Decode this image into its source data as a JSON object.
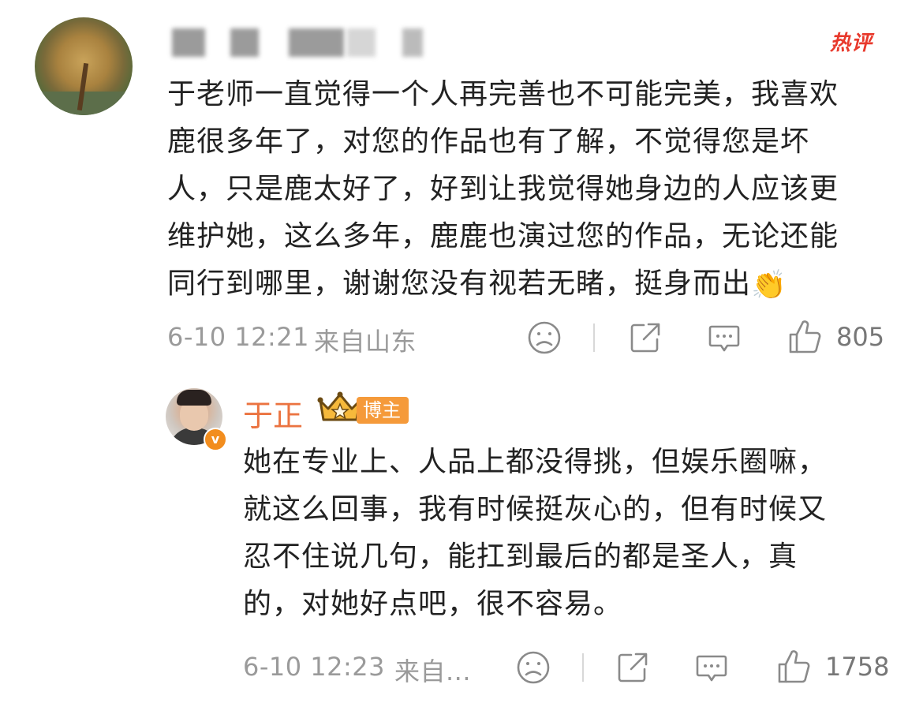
{
  "comment": {
    "hot_tag": "热评",
    "text_lines": [
      "于老师一直觉得一个人再完善也不可能完美，我喜欢",
      "鹿很多年了，对您的作品也有了解，不觉得您是坏",
      "人，只是鹿太好了，好到让我觉得她身边的人应该更",
      "维护她，这么多年，鹿鹿也演过您的作品，无论还能",
      "同行到哪里，谢谢您没有视若无睹，挺身而出"
    ],
    "emoji": "👏",
    "timestamp": "6-10 12:21",
    "location": "来自山东",
    "like_count": "805"
  },
  "reply": {
    "author": "于正",
    "badge_label": "博主",
    "verified_mark": "v",
    "text_lines": [
      "她在专业上、人品上都没得挑，但娱乐圈嘛，",
      "就这么回事，我有时候挺灰心的，但有时候又",
      "忍不住说几句，能扛到最后的都是圣人，真",
      "的，对她好点吧，很不容易。"
    ],
    "timestamp": "6-10 12:23",
    "location": "来自...",
    "like_count": "1758"
  },
  "icons": {
    "sad_face": "sad-face-icon",
    "share": "share-icon",
    "comment": "comment-icon",
    "like": "thumbs-up-icon"
  },
  "colors": {
    "hot": "#e8392c",
    "author_name": "#eb7340",
    "badge": "#f59a3a",
    "meta": "#9a9a9a"
  }
}
